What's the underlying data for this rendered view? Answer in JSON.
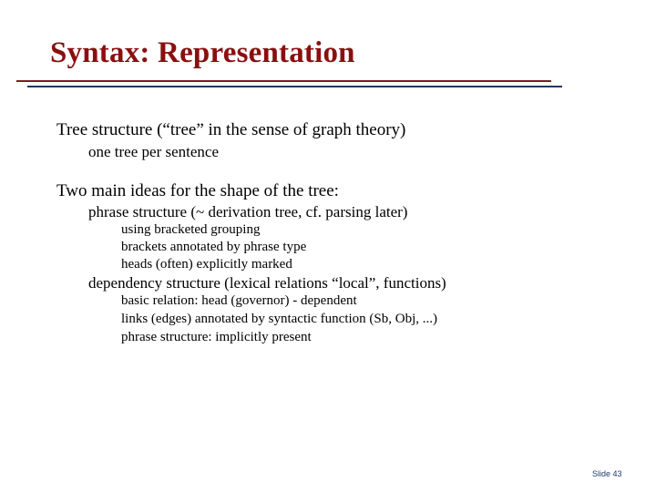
{
  "slide": {
    "title": "Syntax: Representation",
    "slide_number": "Slide 43",
    "colors": {
      "title": "#8b0f10",
      "rule_top": "#7a1c1c",
      "rule_bottom": "#1f3a5f"
    }
  },
  "content": [
    {
      "level": 1,
      "text": "Tree structure (“tree” in the sense of graph theory)"
    },
    {
      "level": 2,
      "text": "one tree per sentence"
    },
    {
      "level": 1,
      "text": "Two main ideas for the shape of the tree:"
    },
    {
      "level": 2,
      "text": "phrase structure (~ derivation tree, cf. parsing later)"
    },
    {
      "level": 3,
      "text": "using bracketed grouping"
    },
    {
      "level": 3,
      "text": "brackets annotated by phrase type"
    },
    {
      "level": 3,
      "text": "heads (often) explicitly marked"
    },
    {
      "level": 2,
      "text": "dependency structure (lexical relations “local”, functions)"
    },
    {
      "level": 3,
      "text": "basic relation: head (governor) - dependent"
    },
    {
      "level": 3,
      "text": "links (edges) annotated by syntactic function (Sb, Obj, ...)"
    },
    {
      "level": 3,
      "text": "phrase structure: implicitly present"
    }
  ]
}
